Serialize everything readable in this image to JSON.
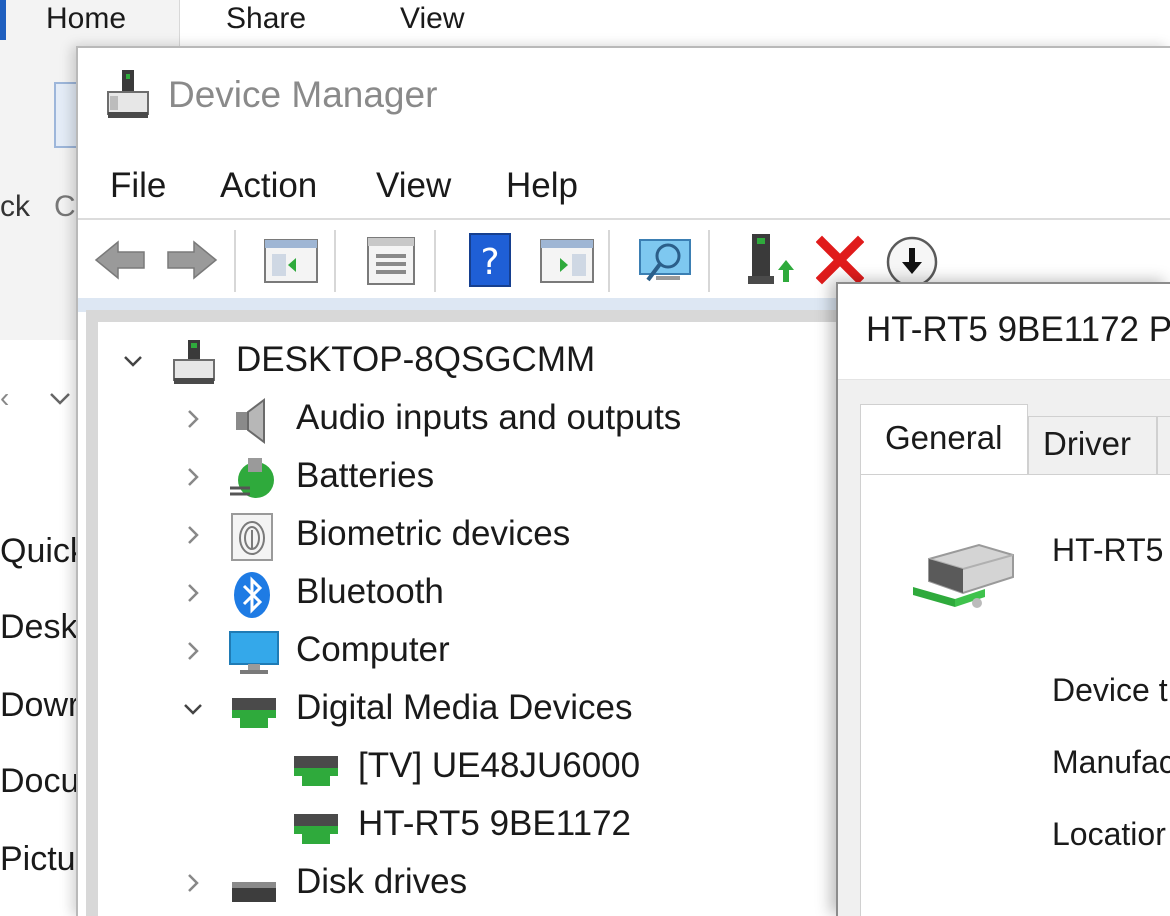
{
  "explorer": {
    "ribbon_tabs": [
      "Home",
      "Share",
      "View"
    ],
    "ribbon_labels": [
      "ck",
      "C"
    ],
    "sidebar_items": [
      "Quick a",
      "Desk",
      "Dowr",
      "Docu",
      "Pictu"
    ]
  },
  "device_manager": {
    "title": "Device Manager",
    "menu": [
      "File",
      "Action",
      "View",
      "Help"
    ],
    "toolbar_icons": [
      "back-arrow-icon",
      "forward-arrow-icon",
      "show-hide-console-tree-icon",
      "properties-icon",
      "help-icon",
      "action-pane-icon",
      "scan-hardware-icon",
      "update-driver-icon",
      "uninstall-device-icon",
      "disable-device-icon"
    ],
    "tree": {
      "root": "DESKTOP-8QSGCMM",
      "categories": [
        {
          "label": "Audio inputs and outputs",
          "icon": "speaker-icon",
          "expanded": false
        },
        {
          "label": "Batteries",
          "icon": "battery-icon",
          "expanded": false
        },
        {
          "label": "Biometric devices",
          "icon": "fingerprint-icon",
          "expanded": false
        },
        {
          "label": "Bluetooth",
          "icon": "bluetooth-icon",
          "expanded": false
        },
        {
          "label": "Computer",
          "icon": "monitor-icon",
          "expanded": false
        },
        {
          "label": "Digital Media Devices",
          "icon": "media-device-icon",
          "expanded": true,
          "children": [
            "[TV] UE48JU6000",
            "HT-RT5 9BE1172"
          ]
        },
        {
          "label": "Disk drives",
          "icon": "disk-drive-icon",
          "expanded": false
        }
      ]
    }
  },
  "properties": {
    "title": "HT-RT5 9BE1172 P",
    "tabs": [
      "General",
      "Driver"
    ],
    "device_name": "HT-RT5",
    "fields": [
      "Device t",
      "Manufac",
      "Locatior"
    ]
  },
  "colors": {
    "delete_red": "#e01b1b",
    "help_blue": "#1f5fd6",
    "media_green": "#2faa3c",
    "bluetooth_blue": "#1e7be4"
  }
}
